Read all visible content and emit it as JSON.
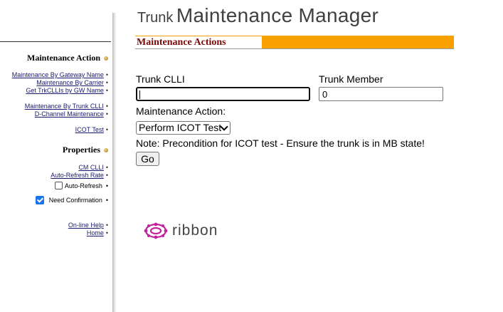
{
  "header": {
    "title_small": "Trunk",
    "title_large": "Maintenance Manager"
  },
  "sidebar": {
    "maintenance_heading": "Maintenance Action",
    "maintenance_links": [
      "Maintenance By Gateway Name",
      "Maintenance By Carrier",
      "Get TrkCLLIs by GW Name",
      "Maintenance By Trunk CLLI",
      "D-Channel Maintenance",
      "ICOT Test"
    ],
    "properties_heading": "Properties",
    "properties_links": [
      "CM CLLI",
      "Auto-Refresh Rate"
    ],
    "auto_refresh_label": "Auto-Refresh",
    "auto_refresh_checked": false,
    "need_confirmation_label": "Need Confirmation",
    "need_confirmation_checked": true,
    "help_links": [
      "On-line Help",
      "Home"
    ],
    "bullet": "•"
  },
  "section": {
    "title": "Maintenance Actions"
  },
  "form": {
    "trunk_clli_label": "Trunk CLLI",
    "trunk_clli_value": "",
    "trunk_member_label": "Trunk Member",
    "trunk_member_value": "0",
    "action_label": "Maintenance Action:",
    "action_selected": "Perform ICOT Test",
    "note": "Note: Precondition for ICOT test - Ensure the trunk is in MB state!",
    "go_label": "Go"
  },
  "logo": {
    "text": "ribbon"
  },
  "colors": {
    "accent_orange": "#f9a100",
    "section_title": "#7a0a0a",
    "checkbox_blue": "#1a73e8",
    "logo_magenta": "#c0239a"
  }
}
